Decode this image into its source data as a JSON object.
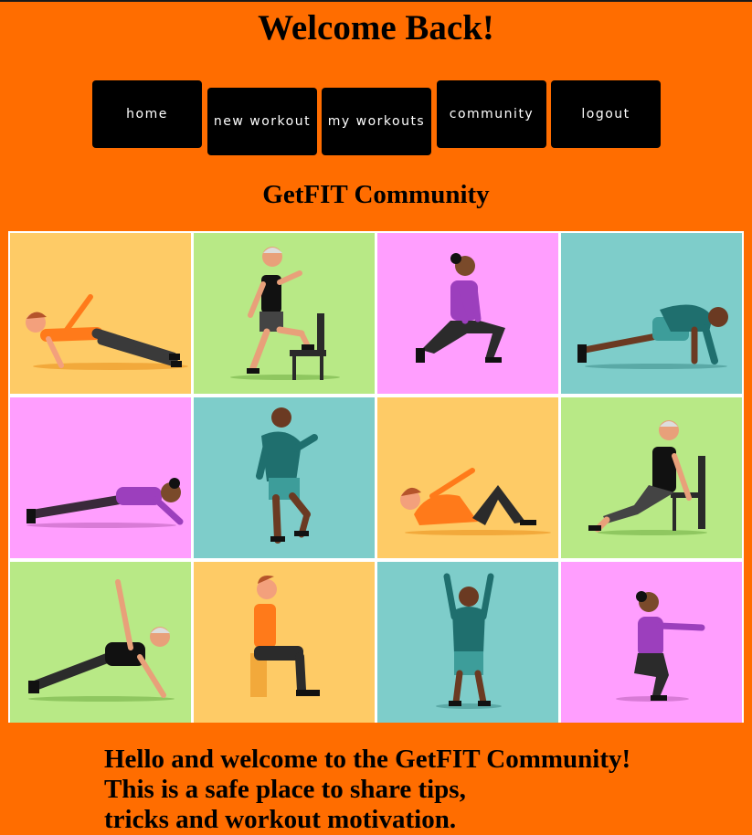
{
  "header": {
    "title": "Welcome Back!"
  },
  "nav": {
    "items": [
      {
        "label": "home"
      },
      {
        "label": "new workout"
      },
      {
        "label": "my workouts"
      },
      {
        "label": "community"
      },
      {
        "label": "logout"
      }
    ]
  },
  "section": {
    "title": "GetFIT Community"
  },
  "gallery": {
    "tiles": [
      {
        "bg": "#fecb66",
        "pose": "side-plank"
      },
      {
        "bg": "#b8e986",
        "pose": "step-up-chair"
      },
      {
        "bg": "#ff9efe",
        "pose": "lunge"
      },
      {
        "bg": "#7ecdca",
        "pose": "push-up"
      },
      {
        "bg": "#ff9efe",
        "pose": "forearm-plank"
      },
      {
        "bg": "#7ecdca",
        "pose": "high-knees"
      },
      {
        "bg": "#fecb66",
        "pose": "crunch"
      },
      {
        "bg": "#b8e986",
        "pose": "chair-dip"
      },
      {
        "bg": "#b8e986",
        "pose": "side-plank-reach"
      },
      {
        "bg": "#fecb66",
        "pose": "wall-sit"
      },
      {
        "bg": "#7ecdca",
        "pose": "jumping-jack"
      },
      {
        "bg": "#ff9efe",
        "pose": "squat"
      }
    ]
  },
  "welcome": {
    "lines": [
      "Hello and welcome to the GetFIT Community!",
      "This is a safe place to share tips,",
      "tricks and workout motivation."
    ]
  },
  "colors": {
    "page_bg": "#ff6d00",
    "button_bg": "#000000",
    "button_text": "#ffffff"
  }
}
